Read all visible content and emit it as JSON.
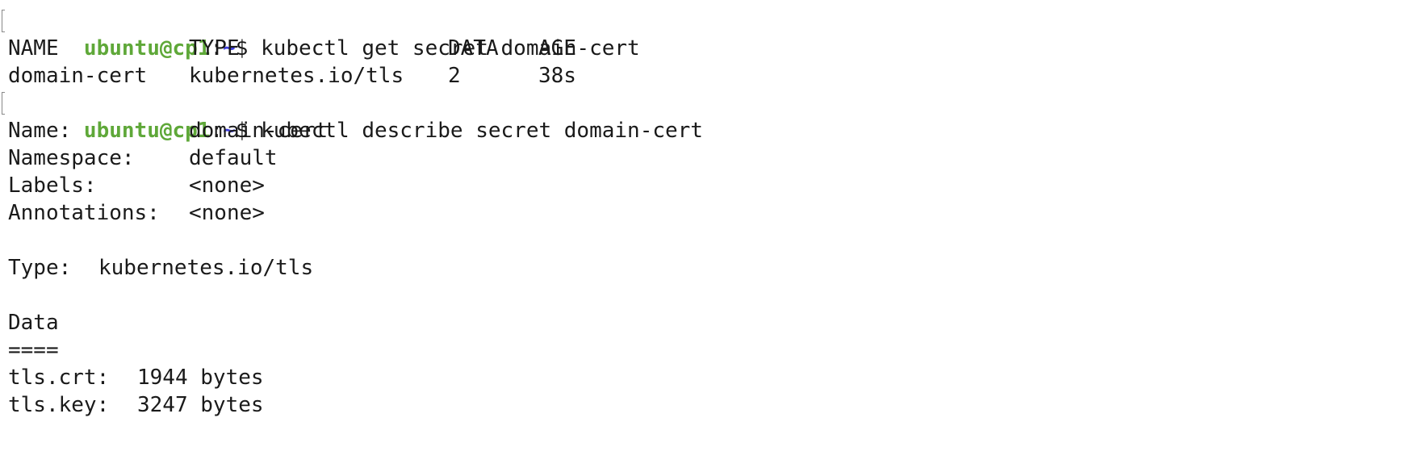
{
  "prompt": {
    "user_host": "ubuntu@cp1",
    "separator": ":",
    "path": "~",
    "symbol": "$"
  },
  "commands": [
    "kubectl get secret domain-cert",
    "kubectl describe secret domain-cert"
  ],
  "get_table": {
    "headers": [
      "NAME",
      "TYPE",
      "DATA",
      "AGE"
    ],
    "rows": [
      [
        "domain-cert",
        "kubernetes.io/tls",
        "2",
        "38s"
      ]
    ]
  },
  "describe": {
    "fields": [
      {
        "key": "Name:",
        "value": "domain-cert"
      },
      {
        "key": "Namespace:",
        "value": "default"
      },
      {
        "key": "Labels:",
        "value": "<none>"
      },
      {
        "key": "Annotations:",
        "value": "<none>"
      }
    ],
    "type_key": "Type:",
    "type_value": "kubernetes.io/tls",
    "data_heading": "Data",
    "data_rule": "====",
    "data_items": [
      {
        "key": "tls.crt:",
        "value": "1944 bytes"
      },
      {
        "key": "tls.key:",
        "value": "3247 bytes"
      }
    ]
  }
}
